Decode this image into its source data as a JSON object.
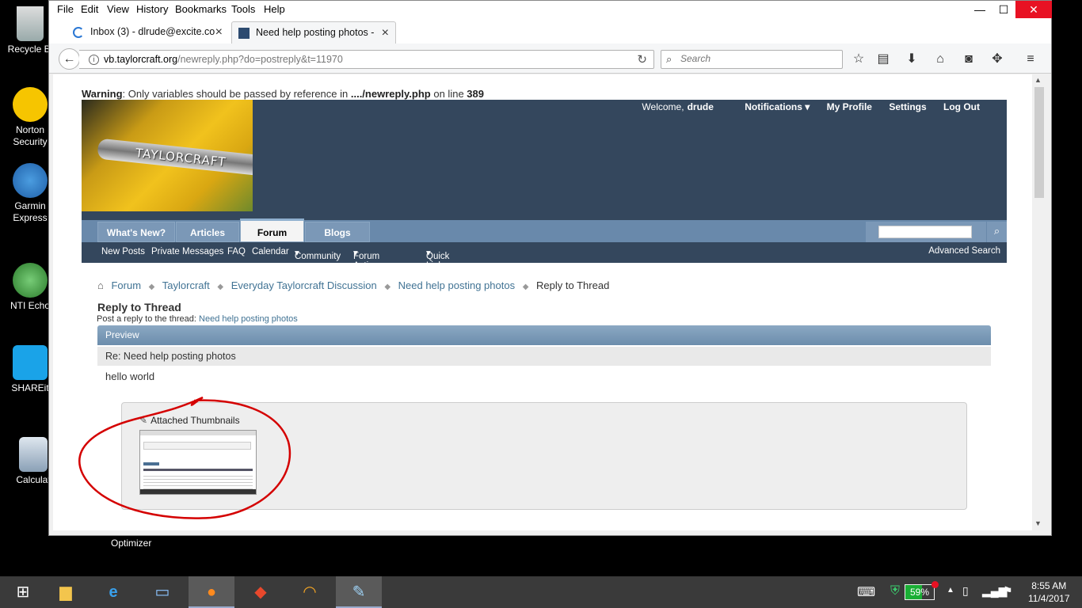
{
  "desktop": {
    "icons": [
      {
        "label": "Recycle Bi",
        "name": "recycle-bin-icon"
      },
      {
        "label": "Norton Security",
        "name": "norton-security-icon"
      },
      {
        "label": "Garmin Express",
        "name": "garmin-express-icon"
      },
      {
        "label": "NTI Echo",
        "name": "nti-echo-icon"
      },
      {
        "label": "SHAREit",
        "name": "shareit-icon"
      },
      {
        "label": "Calculat",
        "name": "calculator-icon"
      }
    ],
    "optimizer_label": "Optimizer"
  },
  "browser": {
    "menu": [
      "File",
      "Edit",
      "View",
      "History",
      "Bookmarks",
      "Tools",
      "Help"
    ],
    "window_controls": {
      "minimize": "—",
      "maximize": "☐",
      "close": "✕"
    },
    "tabs": [
      {
        "label": "Inbox (3) - dlrude@excite.co",
        "active": false
      },
      {
        "label": "Need help posting photos -",
        "active": true
      }
    ],
    "new_tab": "+",
    "url_domain": "vb.taylorcraft.org",
    "url_path": "/newreply.php?do=postreply&t=11970",
    "search_placeholder": "Search",
    "toolbar_icons": [
      "star-icon",
      "reading-list-icon",
      "download-icon",
      "home-icon",
      "pocket-icon",
      "extensions-icon",
      "menu-icon"
    ]
  },
  "page": {
    "warning_label": "Warning",
    "warning_text": ": Only variables should be passed by reference in ",
    "warning_file": "..../newreply.php",
    "warning_online": " on line ",
    "warning_line": "389",
    "logo_text": "TAYLORCRAFT",
    "toplinks": {
      "welcome": "Welcome,",
      "user": "drude",
      "notifications": "Notifications",
      "profile": "My Profile",
      "settings": "Settings",
      "logout": "Log Out"
    },
    "navtabs": [
      "What's New?",
      "Articles",
      "Forum",
      "Blogs"
    ],
    "selected_tab": "Forum",
    "subnav": [
      "New Posts",
      "Private Messages",
      "FAQ",
      "Calendar",
      "Community",
      "Forum Actions",
      "Quick Links"
    ],
    "advanced_search": "Advanced Search",
    "breadcrumb": [
      "Forum",
      "Taylorcraft",
      "Everyday Taylorcraft Discussion",
      "Need help posting photos",
      "Reply to Thread"
    ],
    "title": "Reply to Thread",
    "desc_prefix": "Post a reply to the thread: ",
    "desc_link": "Need help posting photos",
    "preview_label": "Preview",
    "preview_subject": "Re: Need help posting photos",
    "preview_body": "hello world",
    "attachments_label": "Attached Thumbnails"
  },
  "taskbar": {
    "battery": "59%",
    "time": "8:55 AM",
    "date": "11/4/2017"
  },
  "colors": {
    "header_bg": "#34475d",
    "navtab_bg": "#6989ab",
    "link": "#417394",
    "annotation_red": "#d40000"
  }
}
